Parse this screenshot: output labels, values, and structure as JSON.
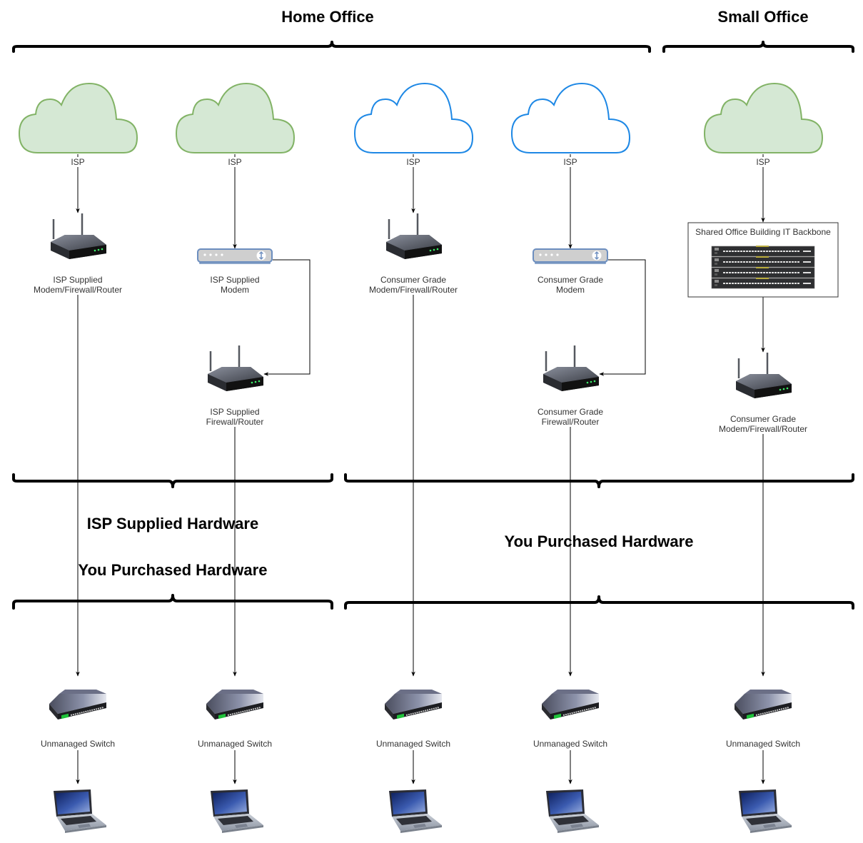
{
  "groups": {
    "home_office": "Home Office",
    "small_office": "Small Office"
  },
  "bands": {
    "isp_supplied": "ISP Supplied Hardware",
    "you_purchased_left": "You Purchased Hardware",
    "you_purchased_right": "You Purchased Hardware"
  },
  "colors": {
    "isp_cloud_fill": "#d5e8d4",
    "isp_cloud_stroke": "#82b366",
    "own_cloud_fill": "#ffffff",
    "own_cloud_stroke": "#1e88e5",
    "modem_fill": "#cfcfcf",
    "modem_stroke": "#6c8ebf"
  },
  "columns": [
    {
      "cloud": "ISP",
      "cloud_style": "isp",
      "devices": [
        {
          "type": "router",
          "label": [
            "ISP Supplied",
            "Modem/Firewall/Router"
          ]
        }
      ],
      "switch": "Unmanaged Switch",
      "endpoint": "laptop"
    },
    {
      "cloud": "ISP",
      "cloud_style": "isp",
      "devices": [
        {
          "type": "modem",
          "label": [
            "ISP Supplied",
            "Modem"
          ]
        },
        {
          "type": "router",
          "label": [
            "ISP Supplied",
            "Firewall/Router"
          ]
        }
      ],
      "switch": "Unmanaged Switch",
      "endpoint": "laptop"
    },
    {
      "cloud": "ISP",
      "cloud_style": "own",
      "devices": [
        {
          "type": "router",
          "label": [
            "Consumer Grade",
            "Modem/Firewall/Router"
          ]
        }
      ],
      "switch": "Unmanaged Switch",
      "endpoint": "laptop"
    },
    {
      "cloud": "ISP",
      "cloud_style": "own",
      "devices": [
        {
          "type": "modem",
          "label": [
            "Consumer Grade",
            "Modem"
          ]
        },
        {
          "type": "router",
          "label": [
            "Consumer Grade",
            "Firewall/Router"
          ]
        }
      ],
      "switch": "Unmanaged Switch",
      "endpoint": "laptop"
    },
    {
      "cloud": "ISP",
      "cloud_style": "isp",
      "devices": [
        {
          "type": "backbone",
          "label": [
            "Shared Office Building IT Backbone"
          ]
        },
        {
          "type": "router",
          "label": [
            "Consumer Grade",
            "Modem/Firewall/Router"
          ]
        }
      ],
      "switch": "Unmanaged Switch",
      "endpoint": "laptop"
    }
  ]
}
